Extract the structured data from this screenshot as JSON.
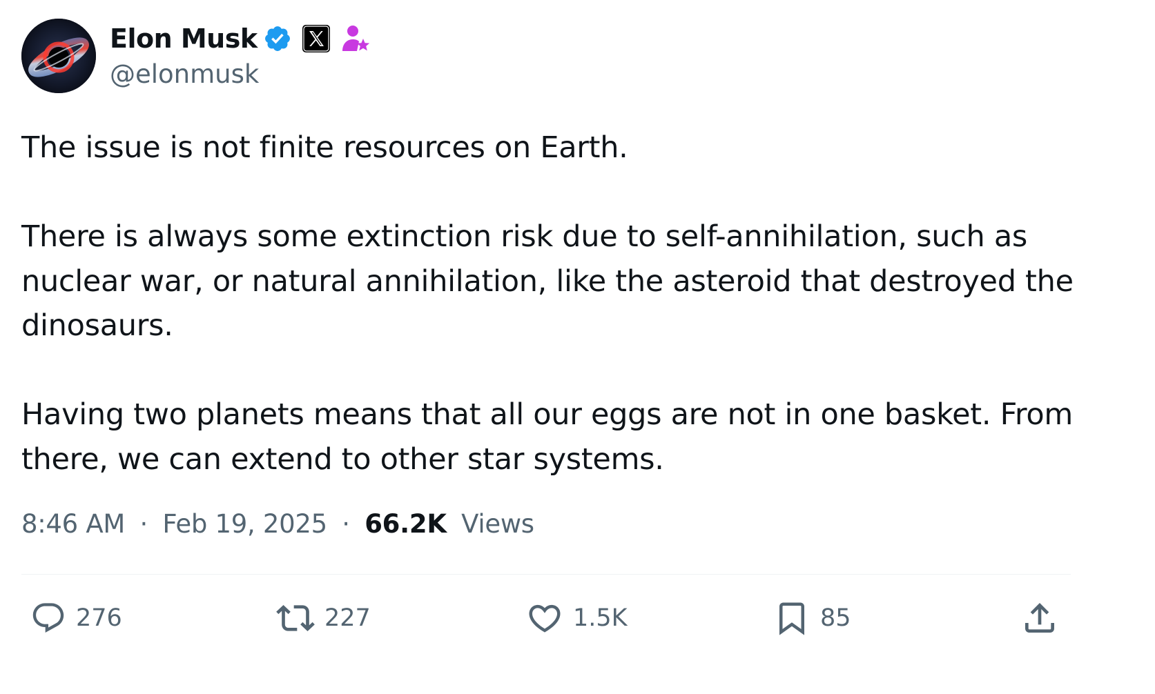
{
  "author": {
    "display_name": "Elon Musk",
    "handle": "@elonmusk",
    "badges": [
      "verified-badge-icon",
      "x-affiliate-icon",
      "subscriber-star-icon"
    ],
    "colors": {
      "verified": "#1d9bf0",
      "affiliate_bg": "#000000",
      "subscriber": "#c839e0"
    }
  },
  "tweet": {
    "paragraphs": [
      "The issue is not finite resources on Earth.",
      "There is always some extinction risk due to self-annihilation, such as nuclear war, or natural annihilation, like the asteroid that destroyed the dinosaurs.",
      "Having two planets means that all our eggs are not in one basket. From there, we can extend to other star systems."
    ]
  },
  "meta": {
    "time": "8:46 AM",
    "separator": "·",
    "date": "Feb 19, 2025",
    "views_count": "66.2K",
    "views_label": "Views"
  },
  "actions": {
    "reply": {
      "icon": "reply-icon",
      "count": "276"
    },
    "repost": {
      "icon": "repost-icon",
      "count": "227"
    },
    "like": {
      "icon": "heart-icon",
      "count": "1.5K"
    },
    "bookmark": {
      "icon": "bookmark-icon",
      "count": "85"
    },
    "share": {
      "icon": "share-icon"
    }
  },
  "colors": {
    "text_primary": "#0f1419",
    "text_secondary": "#536471",
    "divider": "#eff3f4"
  }
}
